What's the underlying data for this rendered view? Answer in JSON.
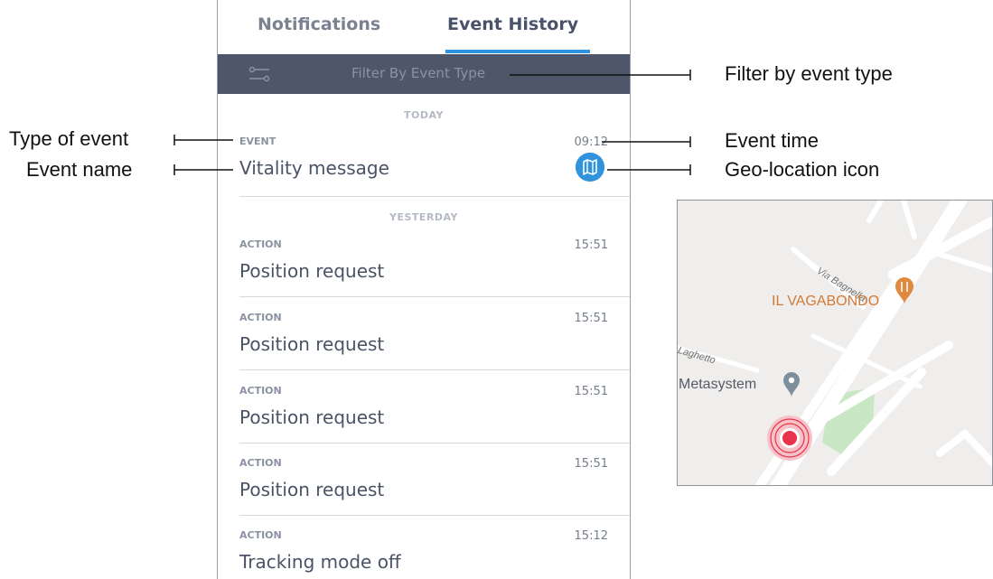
{
  "tabs": {
    "notifications": "Notifications",
    "event_history": "Event History"
  },
  "filter": {
    "label": "Filter By Event Type"
  },
  "sections": {
    "today": "TODAY",
    "yesterday": "YESTERDAY"
  },
  "events": [
    {
      "type": "EVENT",
      "time": "09:12",
      "name": "Vitality message"
    },
    {
      "type": "ACTION",
      "time": "15:51",
      "name": "Position request"
    },
    {
      "type": "ACTION",
      "time": "15:51",
      "name": "Position request"
    },
    {
      "type": "ACTION",
      "time": "15:51",
      "name": "Position request"
    },
    {
      "type": "ACTION",
      "time": "15:51",
      "name": "Position request"
    },
    {
      "type": "ACTION",
      "time": "15:12",
      "name": "Tracking mode off"
    }
  ],
  "annotations": {
    "filter_by_event_type": "Filter by event type",
    "type_of_event": "Type of event",
    "event_name": "Event name",
    "event_time": "Event time",
    "geo_location_icon": "Geo-location icon"
  },
  "map": {
    "street_bagnella": "Via Bagnella",
    "restaurant": "IL VAGABONDO",
    "street_laghetto": "Laghetto",
    "company": "Metasystem"
  },
  "colors": {
    "accent": "#2f93dd",
    "filter_bar": "#4e566a",
    "map_bg": "#efeeec",
    "map_park": "#c9e7c4",
    "restaurant": "#e0883c",
    "marker": "#e8334a"
  },
  "icons": [
    "filter-sliders-icon",
    "map-icon",
    "restaurant-pin-icon",
    "place-pin-icon",
    "location-marker-icon"
  ]
}
